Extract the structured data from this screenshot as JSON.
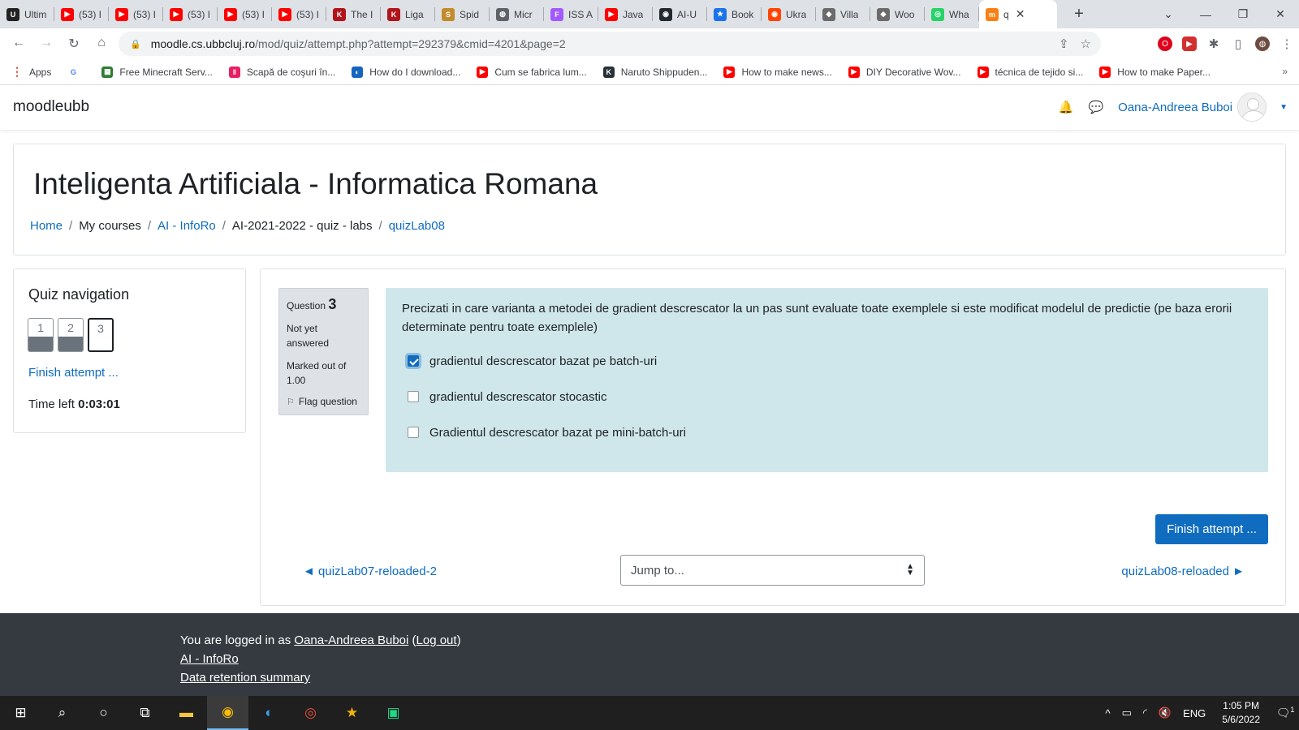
{
  "browser": {
    "tabs": [
      {
        "title": "Ultim",
        "color": "#222222",
        "glyph": "U"
      },
      {
        "title": "(53) I",
        "color": "#ff0000",
        "glyph": "▶"
      },
      {
        "title": "(53) I",
        "color": "#ff0000",
        "glyph": "▶"
      },
      {
        "title": "(53) I",
        "color": "#ff0000",
        "glyph": "▶"
      },
      {
        "title": "(53) I",
        "color": "#ff0000",
        "glyph": "▶"
      },
      {
        "title": "(53) I",
        "color": "#ff0000",
        "glyph": "▶"
      },
      {
        "title": "The I",
        "color": "#b1141a",
        "glyph": "K"
      },
      {
        "title": "Liga",
        "color": "#b1141a",
        "glyph": "K"
      },
      {
        "title": "Spid",
        "color": "#c28b2c",
        "glyph": "S"
      },
      {
        "title": "Micr",
        "color": "#5f6368",
        "glyph": "◍"
      },
      {
        "title": "ISS A",
        "color": "#a259ff",
        "glyph": "F"
      },
      {
        "title": "Java",
        "color": "#ff0000",
        "glyph": "▶"
      },
      {
        "title": "AI-U",
        "color": "#24292f",
        "glyph": "◉"
      },
      {
        "title": "Book",
        "color": "#1a73e8",
        "glyph": "★"
      },
      {
        "title": "Ukra",
        "color": "#ff4500",
        "glyph": "◉"
      },
      {
        "title": "Villa",
        "color": "#6b6b6b",
        "glyph": "◆"
      },
      {
        "title": "Woo",
        "color": "#6b6b6b",
        "glyph": "◆"
      },
      {
        "title": "Wha",
        "color": "#25d366",
        "glyph": "◎"
      },
      {
        "title": "q",
        "color": "#f98012",
        "glyph": "m",
        "active": true
      }
    ],
    "url_host": "moodle.cs.ubbcluj.ro",
    "url_path": "/mod/quiz/attempt.php?attempt=292379&cmid=4201&page=2",
    "bookmarks": [
      {
        "label": "Apps",
        "color": "#4285f4",
        "glyph": "⋮"
      },
      {
        "label": "",
        "color": "#ffffff",
        "glyph": "G"
      },
      {
        "label": "Free Minecraft Serv...",
        "color": "#2e7d32",
        "glyph": "▦"
      },
      {
        "label": "Scapă de coşuri în...",
        "color": "#e91e63",
        "glyph": "‖"
      },
      {
        "label": "How do I download...",
        "color": "#1565c0",
        "glyph": "◐"
      },
      {
        "label": "Cum se fabrica lum...",
        "color": "#ff0000",
        "glyph": "▶"
      },
      {
        "label": "Naruto Shippuden...",
        "color": "#263238",
        "glyph": "K"
      },
      {
        "label": "How to make news...",
        "color": "#ff0000",
        "glyph": "▶"
      },
      {
        "label": "DIY Decorative Wov...",
        "color": "#ff0000",
        "glyph": "▶"
      },
      {
        "label": "técnica de tejido si...",
        "color": "#ff0000",
        "glyph": "▶"
      },
      {
        "label": "How to make Paper...",
        "color": "#ff0000",
        "glyph": "▶"
      }
    ],
    "bookmarks_more": "»"
  },
  "moodle": {
    "brand": "moodleubb",
    "user_name": "Oana-Andreea Buboi",
    "course_title": "Inteligenta Artificiala - Informatica Romana",
    "breadcrumb": [
      "Home",
      "My courses",
      "AI - InfoRo",
      "AI-2021-2022 - quiz - labs",
      "quizLab08"
    ]
  },
  "quiz_nav": {
    "title": "Quiz navigation",
    "buttons": [
      "1",
      "2",
      "3"
    ],
    "finish_link": "Finish attempt ...",
    "time_label": "Time left",
    "time_value": "0:03:01"
  },
  "question": {
    "label": "Question",
    "number": "3",
    "state": "Not yet answered",
    "grade": "Marked out of 1.00",
    "flag": "Flag question",
    "text": "Precizati in care varianta a metodei de gradient descrescator la un pas sunt evaluate toate exemplele si este modificat modelul de predictie (pe baza erorii determinate pentru toate exemplele)",
    "options": [
      {
        "label": "gradientul descrescator bazat pe batch-uri",
        "checked": true
      },
      {
        "label": "gradientul descrescator stocastic",
        "checked": false
      },
      {
        "label": "Gradientul descrescator bazat pe mini-batch-uri",
        "checked": false
      }
    ]
  },
  "nav": {
    "finish_button": "Finish attempt ...",
    "prev_link": "◄ quizLab07-reloaded-2",
    "jump_placeholder": "Jump to...",
    "next_link": "quizLab08-reloaded ►"
  },
  "footer": {
    "logged_prefix": "You are logged in as",
    "user": "Oana-Andreea Buboi",
    "logout": "Log out",
    "course_link": "AI - InfoRo",
    "data_retention": "Data retention summary"
  },
  "taskbar": {
    "lang": "ENG",
    "time": "1:05 PM",
    "date": "5/6/2022",
    "notif_count": "1"
  },
  "colors": {
    "accent": "#0f6cbf",
    "formulation_bg": "#cfe7ea",
    "footer_bg": "#343a40"
  }
}
